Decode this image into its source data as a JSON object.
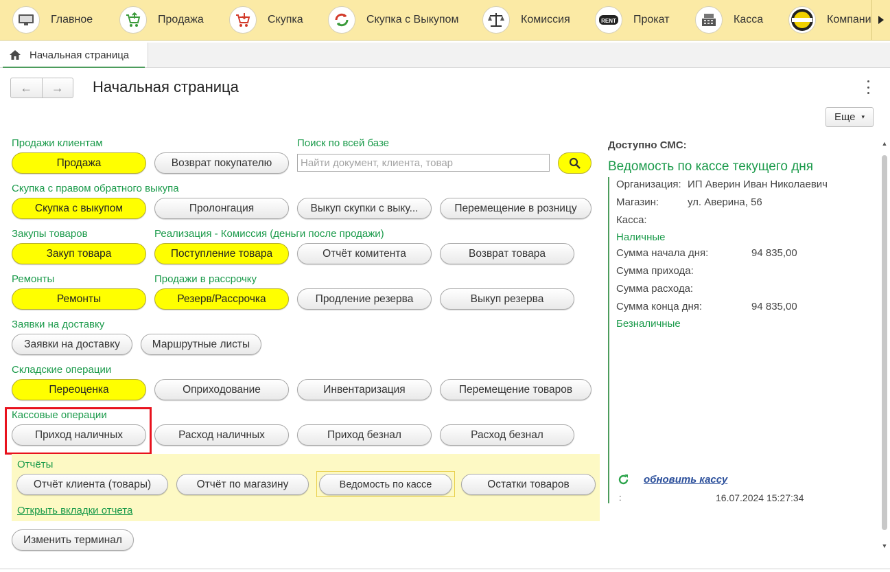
{
  "sections": [
    {
      "label": "Главное",
      "icon": "monitor-icon"
    },
    {
      "label": "Продажа",
      "icon": "cart-up-icon"
    },
    {
      "label": "Скупка",
      "icon": "cart-down-icon"
    },
    {
      "label": "Скупка с Выкупом",
      "icon": "cycle-arrows-icon"
    },
    {
      "label": "Комиссия",
      "icon": "scales-icon"
    },
    {
      "label": "Прокат",
      "icon": "rent-icon"
    },
    {
      "label": "Касса",
      "icon": "cash-register-icon"
    },
    {
      "label": "Компани",
      "icon": "company-logo-icon"
    }
  ],
  "tab": {
    "label": "Начальная страница"
  },
  "page": {
    "title": "Начальная страница",
    "more_label": "Еще"
  },
  "groups": {
    "sales": "Продажи клиентам",
    "search": "Поиск по всей базе",
    "buyback": "Скупка с правом обратного выкупа",
    "purchases": "Закупы товаров",
    "commission": "Реализация - Комиссия (деньги после продажи)",
    "repairs": "Ремонты",
    "installments": "Продажи в рассрочку",
    "delivery": "Заявки на доставку",
    "warehouse": "Складские операции",
    "cash": "Кассовые операции",
    "reports": "Отчёты"
  },
  "search": {
    "placeholder": "Найти документ, клиента, товар"
  },
  "buttons": {
    "sale": "Продажа",
    "return_to_buyer": "Возврат покупателю",
    "buyback": "Скупка с выкупом",
    "prolongation": "Пролонгация",
    "redeem_buyback": "Выкуп скупки с выку...",
    "move_to_retail": "Перемещение в розницу",
    "purchase": "Закуп товара",
    "goods_receipt": "Поступление товара",
    "consignor_report": "Отчёт комитента",
    "goods_return": "Возврат товара",
    "repairs": "Ремонты",
    "reserve": "Резерв/Рассрочка",
    "extend_reserve": "Продление резерва",
    "redeem_reserve": "Выкуп резерва",
    "delivery_requests": "Заявки на доставку",
    "route_sheets": "Маршрутные листы",
    "revaluation": "Переоценка",
    "capitalization": "Оприходование",
    "inventory": "Инвентаризация",
    "goods_transfer": "Перемещение товаров",
    "cash_in": "Приход наличных",
    "cash_out": "Расход наличных",
    "noncash_in": "Приход безнал",
    "noncash_out": "Расход безнал",
    "client_report": "Отчёт клиента (товары)",
    "store_report": "Отчёт по магазину",
    "cash_statement": "Ведомость по кассе",
    "stock_balance": "Остатки товаров",
    "open_report_tabs": "Открыть вкладки отчета",
    "change_terminal": "Изменить терминал"
  },
  "right": {
    "sms_caption": "Доступно СМС:",
    "title": "Ведомость по кассе текущего дня",
    "org_label": "Организация:",
    "org_value": "ИП Аверин Иван Николаевич",
    "shop_label": "Магазин:",
    "shop_value": "ул. Аверина, 56",
    "cashbox_label": "Касса:",
    "cash_header": "Наличные",
    "start_label": "Сумма начала дня:",
    "start_value": "94 835,00",
    "income_label": "Сумма прихода:",
    "expense_label": "Сумма расхода:",
    "end_label": "Сумма конца дня:",
    "end_value": "94 835,00",
    "noncash_header": "Безналичные",
    "refresh_link": "обновить кассу",
    "colon": ":",
    "timestamp": "16.07.2024 15:27:34"
  },
  "colors": {
    "accent_green": "#1a9a4a",
    "yellow_button": "#ffff00",
    "topbar": "#fbeaa5",
    "highlight": "#e8121d"
  }
}
